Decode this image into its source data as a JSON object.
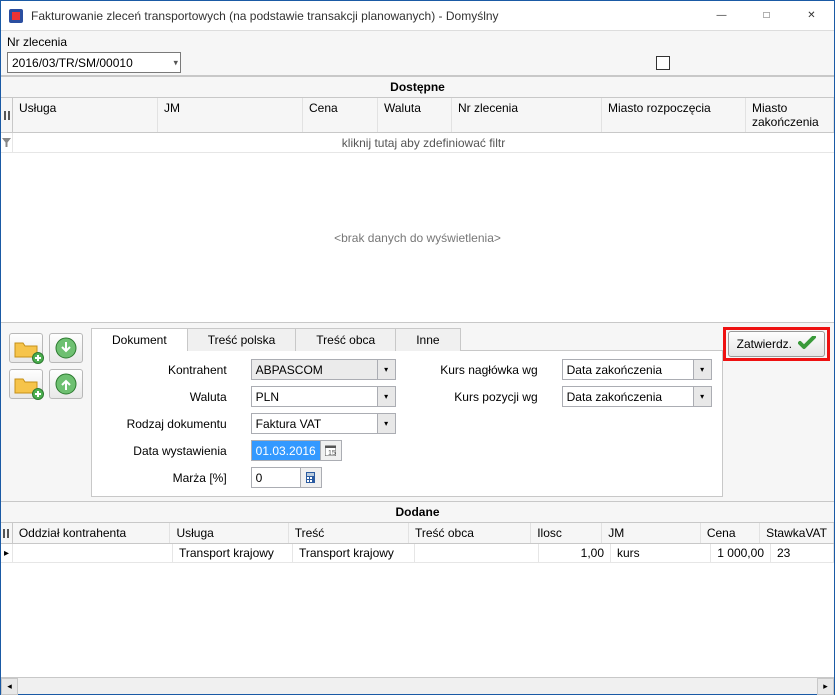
{
  "window": {
    "title": "Fakturowanie zleceń transportowych (na podstawie transakcji planowanych) - Domyślny"
  },
  "order": {
    "label": "Nr zlecenia",
    "value": "2016/03/TR/SM/00010"
  },
  "sections": {
    "available": "Dostępne",
    "added": "Dodane"
  },
  "top_grid": {
    "cols": {
      "usluga": "Usługa",
      "jm": "JM",
      "cena": "Cena",
      "waluta": "Waluta",
      "nr": "Nr zlecenia",
      "miasto_rozp": "Miasto rozpoczęcia",
      "miasto_zak": "Miasto zakończenia"
    },
    "filter_hint": "kliknij tutaj aby zdefiniować filtr",
    "empty": "<brak danych do wyświetlenia>"
  },
  "tabs": {
    "dokument": "Dokument",
    "tresc_polska": "Treść polska",
    "tresc_obca": "Treść obca",
    "inne": "Inne"
  },
  "form": {
    "kontrahent_label": "Kontrahent",
    "kontrahent_value": "ABPASCOM",
    "waluta_label": "Waluta",
    "waluta_value": "PLN",
    "rodzaj_label": "Rodzaj dokumentu",
    "rodzaj_value": "Faktura VAT",
    "data_label": "Data wystawienia",
    "data_value": "01.03.2016",
    "marza_label": "Marża [%]",
    "marza_value": "0",
    "kurs_nagl_label": "Kurs nagłówka wg",
    "kurs_nagl_value": "Data zakończenia",
    "kurs_poz_label": "Kurs pozycji wg",
    "kurs_poz_value": "Data zakończenia"
  },
  "approve": {
    "label": "Zatwierdz."
  },
  "bottom_grid": {
    "cols": {
      "oddzial": "Oddział kontrahenta",
      "usluga": "Usługa",
      "tresc": "Treść",
      "tresc_obca": "Treść obca",
      "ilosc": "Ilosc",
      "jm": "JM",
      "cena": "Cena",
      "vat": "StawkaVAT"
    },
    "rows": [
      {
        "oddzial": "",
        "usluga": "Transport krajowy",
        "tresc": "Transport krajowy",
        "tresc_obca": "",
        "ilosc": "1,00",
        "jm": "kurs",
        "cena": "1 000,00",
        "vat": "23"
      }
    ]
  }
}
